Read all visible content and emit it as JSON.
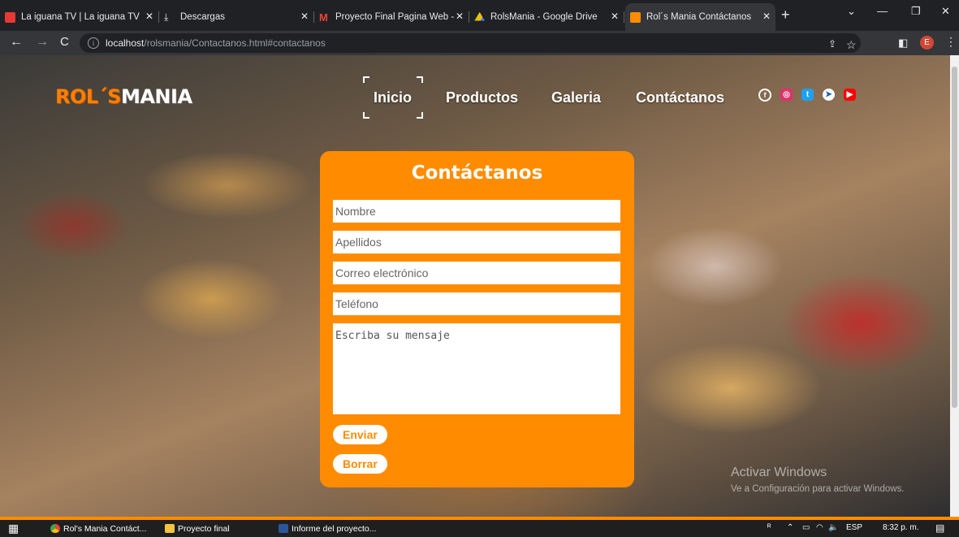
{
  "browser": {
    "tabs": [
      {
        "title": "La iguana TV | La iguana TV",
        "icon": "laiguana-favicon",
        "color": "#e53935"
      },
      {
        "title": "Descargas",
        "icon": "download-icon",
        "color": "#e8eaed"
      },
      {
        "title": "Proyecto Final Pagina Web - ",
        "icon": "gmail-icon",
        "color": "#ea4335"
      },
      {
        "title": "RolsMania - Google Drive",
        "icon": "google-drive-icon",
        "color": "#fbbc04"
      },
      {
        "title": "Rol´s Mania Contáctanos",
        "icon": "site-favicon",
        "color": "#ff8c00"
      }
    ],
    "address": {
      "host": "localhost",
      "path": "/rolsmania/Contactanos.html#contactanos"
    },
    "profile_initial": "E"
  },
  "site": {
    "logo_part1": "ROL´S",
    "logo_part2": "MANIA",
    "nav": [
      "Inicio",
      "Productos",
      "Galeria",
      "Contáctanos"
    ],
    "social_icons": [
      "facebook-icon",
      "instagram-icon",
      "twitter-icon",
      "telegram-icon",
      "youtube-icon"
    ],
    "colors": {
      "accent": "#ff8c00"
    }
  },
  "form": {
    "title": "Contáctanos",
    "nombre_placeholder": "Nombre",
    "apellidos_placeholder": "Apellidos",
    "correo_placeholder": "Correo electrónico",
    "telefono_placeholder": "Teléfono",
    "mensaje_placeholder": "Escriba su mensaje",
    "enviar_label": "Enviar",
    "borrar_label": "Borrar"
  },
  "watermark": {
    "line1": "Activar Windows",
    "line2": "Ve a Configuración para activar Windows."
  },
  "taskbar": {
    "items": [
      "Rol's Mania Contáct...",
      "Proyecto final",
      "Informe del proyecto..."
    ],
    "language": "ESP",
    "time": "8:32 p. m."
  }
}
